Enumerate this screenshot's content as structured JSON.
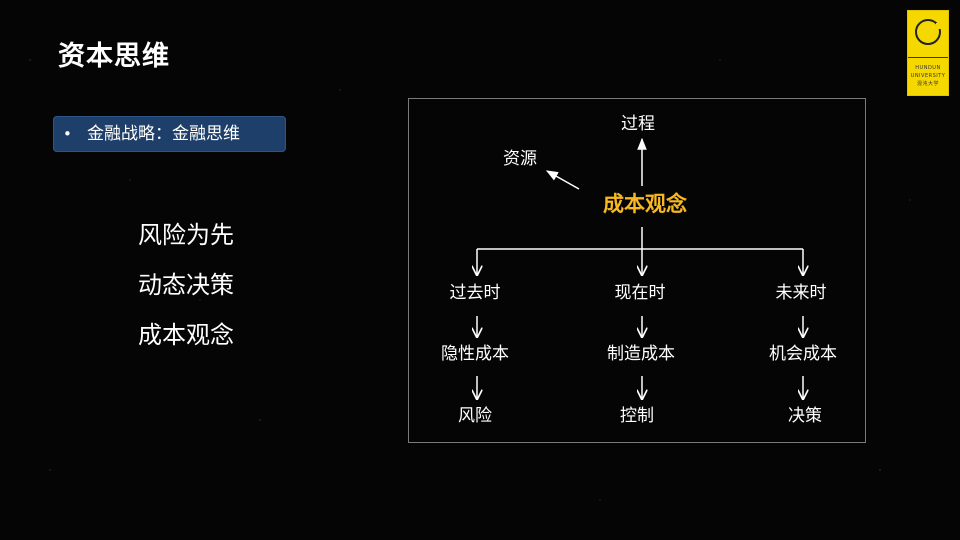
{
  "slide": {
    "title": "资本思维",
    "bullet": "金融战略：金融思维",
    "bullet_marker": "•",
    "points": [
      "风险为先",
      "动态决策",
      "成本观念"
    ]
  },
  "logo": {
    "line1": "HUNDUN",
    "line2": "UNIVERSITY",
    "line3": "混沌大学",
    "color": "#f5d800"
  },
  "diagram": {
    "top": "过程",
    "side": "资源",
    "center": "成本观念",
    "center_color": "#f7b820",
    "columns": [
      {
        "time": "过去时",
        "cost": "隐性成本",
        "result": "风险"
      },
      {
        "time": "现在时",
        "cost": "制造成本",
        "result": "控制"
      },
      {
        "time": "未来时",
        "cost": "机会成本",
        "result": "决策"
      }
    ]
  },
  "theme": {
    "background": "#050505",
    "pill": "#1d3f69",
    "text": "#ffffff",
    "frame": "#7a7a7a"
  }
}
